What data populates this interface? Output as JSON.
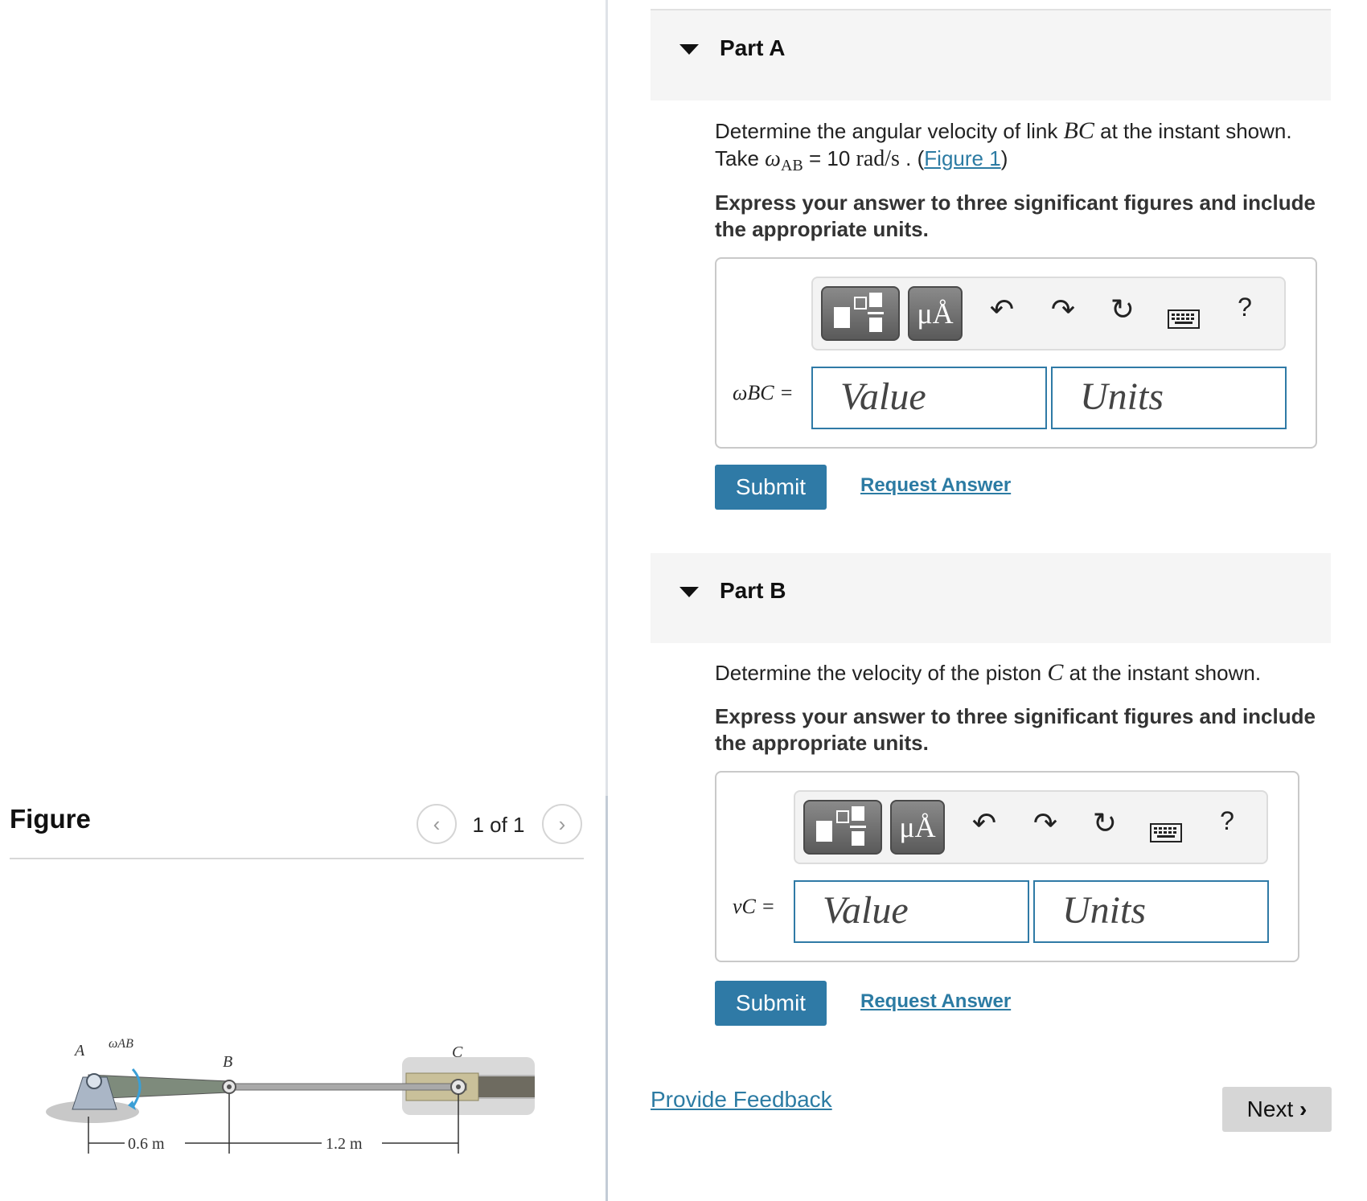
{
  "figure_panel": {
    "title": "Figure",
    "counter": "1 of 1",
    "prev_icon": "chevron-left-icon",
    "next_icon": "chevron-right-icon",
    "diagram": {
      "labels": {
        "a": "A",
        "b": "B",
        "c": "C",
        "omega": "ωAB"
      },
      "dimensions": [
        "0.6 m",
        "1.2 m"
      ]
    }
  },
  "part_a": {
    "title": "Part A",
    "prompt_line1_pre": "Determine the angular velocity of link ",
    "prompt_line1_var": "BC",
    "prompt_line1_post": " at the instant shown.",
    "prompt_line2_pre": "Take ",
    "prompt_line2_omega": "ω",
    "prompt_line2_sub": "AB",
    "prompt_line2_eq": " = 10 ",
    "prompt_line2_unit": "rad/s",
    "prompt_line2_dot": " . (",
    "figure_link": "Figure 1",
    "prompt_line2_close": ")",
    "instruction": "Express your answer to three significant figures and include the appropriate units.",
    "field_label": "ωBC =",
    "value_placeholder": "Value",
    "units_placeholder": "Units",
    "submit": "Submit",
    "request": "Request Answer"
  },
  "part_b": {
    "title": "Part B",
    "prompt_pre": "Determine the velocity of the piston ",
    "prompt_var": "C",
    "prompt_post": " at the instant shown.",
    "instruction": "Express your answer to three significant figures and include the appropriate units.",
    "field_label": "vC =",
    "value_placeholder": "Value",
    "units_placeholder": "Units",
    "submit": "Submit",
    "request": "Request Answer"
  },
  "toolbar": {
    "symbol_button": "μÅ",
    "help": "?",
    "icons": [
      "templates-icon",
      "symbols-icon",
      "undo-icon",
      "redo-icon",
      "reset-icon",
      "keyboard-icon",
      "help-icon"
    ]
  },
  "footer": {
    "feedback": "Provide Feedback",
    "next": "Next"
  }
}
